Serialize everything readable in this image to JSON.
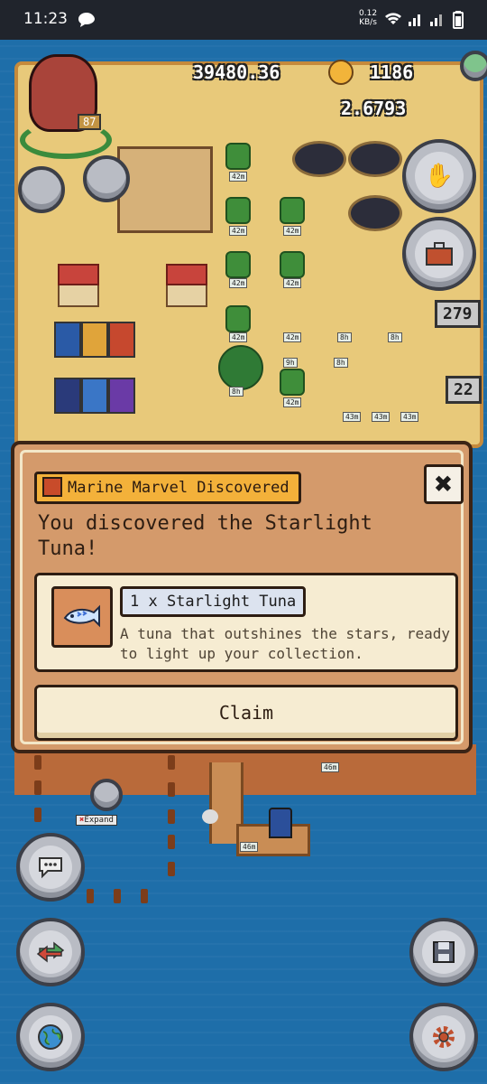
{
  "status_bar": {
    "time": "11:23",
    "net_speed": "0.12",
    "net_unit": "KB/s"
  },
  "hud": {
    "coins": "39480.36",
    "gems": "1186",
    "rate": "2.6793",
    "player_level": "87",
    "tool_count": "279",
    "bag_count": "22"
  },
  "field_timers": [
    "42m",
    "42m",
    "42m",
    "42m",
    "42m",
    "42m",
    "42m",
    "42m",
    "8h",
    "8h",
    "8h",
    "9h",
    "8h",
    "43m",
    "43m",
    "43m",
    "46m",
    "46m"
  ],
  "expand_label": "Expand",
  "dialog": {
    "title": "Marine Marvel Discovered",
    "description": "You discovered the Starlight Tuna!",
    "reward_name": "1 x Starlight Tuna",
    "reward_description": "A tuna that outshines the stars, ready to light up your collection.",
    "claim_label": "Claim"
  },
  "colors": {
    "water": "#1e6ea9",
    "dialog_bg": "#d49a6b",
    "title_tag": "#f3b13a",
    "reward_bg": "#f6ecd2"
  },
  "icons": [
    "message-icon",
    "wifi-icon",
    "signal-icon",
    "battery-icon",
    "add-icon",
    "hand-icon",
    "toolbox-icon",
    "chat-icon",
    "swap-icon",
    "globe-icon",
    "save-icon",
    "settings-icon",
    "hammer-icon",
    "close-icon",
    "tuna-icon"
  ]
}
